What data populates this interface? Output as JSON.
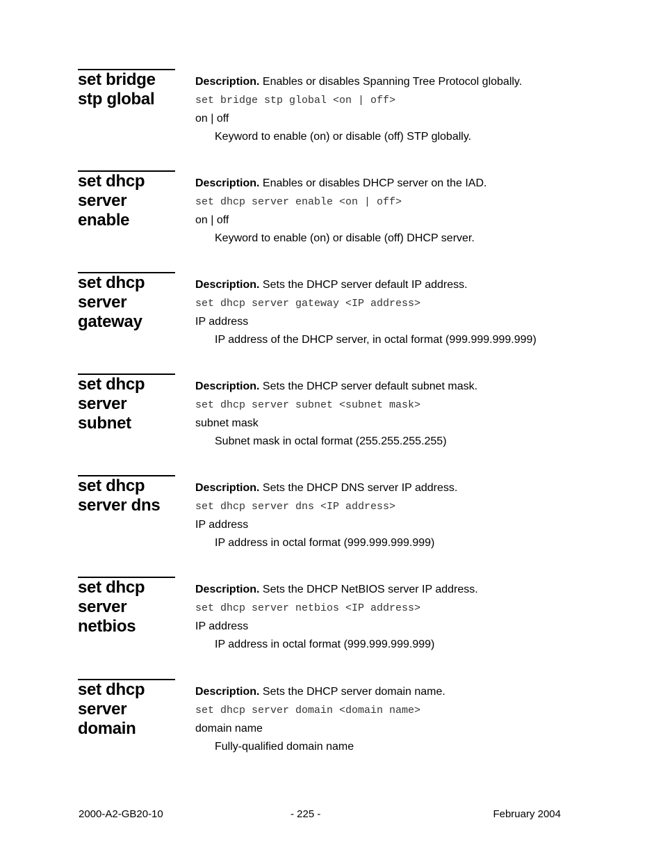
{
  "entries": [
    {
      "heading": [
        "set bridge",
        "stp global"
      ],
      "description_label": "Description.",
      "description": "Enables or disables Spanning Tree Protocol globally.",
      "syntax": "set bridge stp global <on | off>",
      "parameter": "on | off",
      "parameter_description": "Keyword to enable (on) or disable (off) STP globally."
    },
    {
      "heading": [
        "set dhcp",
        "server",
        "enable"
      ],
      "description_label": "Description.",
      "description": "Enables or disables DHCP server on the IAD.",
      "syntax": "set dhcp server enable <on | off>",
      "parameter": "on | off",
      "parameter_description": "Keyword to enable (on) or disable (off) DHCP server."
    },
    {
      "heading": [
        "set dhcp",
        "server",
        "gateway"
      ],
      "description_label": "Description.",
      "description": "Sets the DHCP server default IP address.",
      "syntax": "set dhcp server gateway <IP address>",
      "parameter": "IP address",
      "parameter_description": "IP address of the DHCP server, in octal format (999.999.999.999)"
    },
    {
      "heading": [
        "set dhcp",
        "server",
        "subnet"
      ],
      "description_label": "Description.",
      "description": "Sets the DHCP server default subnet mask.",
      "syntax": "set dhcp server subnet <subnet mask>",
      "parameter": "subnet mask",
      "parameter_description": "Subnet mask in octal format (255.255.255.255)"
    },
    {
      "heading": [
        "set dhcp",
        "server dns"
      ],
      "description_label": "Description.",
      "description": "Sets the DHCP DNS server IP address.",
      "syntax": "set dhcp server dns <IP address>",
      "parameter": "IP address",
      "parameter_description": "IP address in octal format (999.999.999.999)"
    },
    {
      "heading": [
        "set dhcp",
        "server",
        "netbios"
      ],
      "description_label": "Description.",
      "description": "Sets the DHCP NetBIOS server IP address.",
      "syntax": "set dhcp server netbios <IP address>",
      "parameter": "IP address",
      "parameter_description": "IP address in octal format (999.999.999.999)"
    },
    {
      "heading": [
        "set dhcp",
        "server",
        "domain"
      ],
      "description_label": "Description.",
      "description": "Sets the DHCP server domain name.",
      "syntax": "set dhcp server domain <domain name>",
      "parameter": "domain name",
      "parameter_description": "Fully-qualified domain name"
    }
  ],
  "footer": {
    "doc_number": "2000-A2-GB20-10",
    "page": "- 225 -",
    "date": "February 2004"
  }
}
